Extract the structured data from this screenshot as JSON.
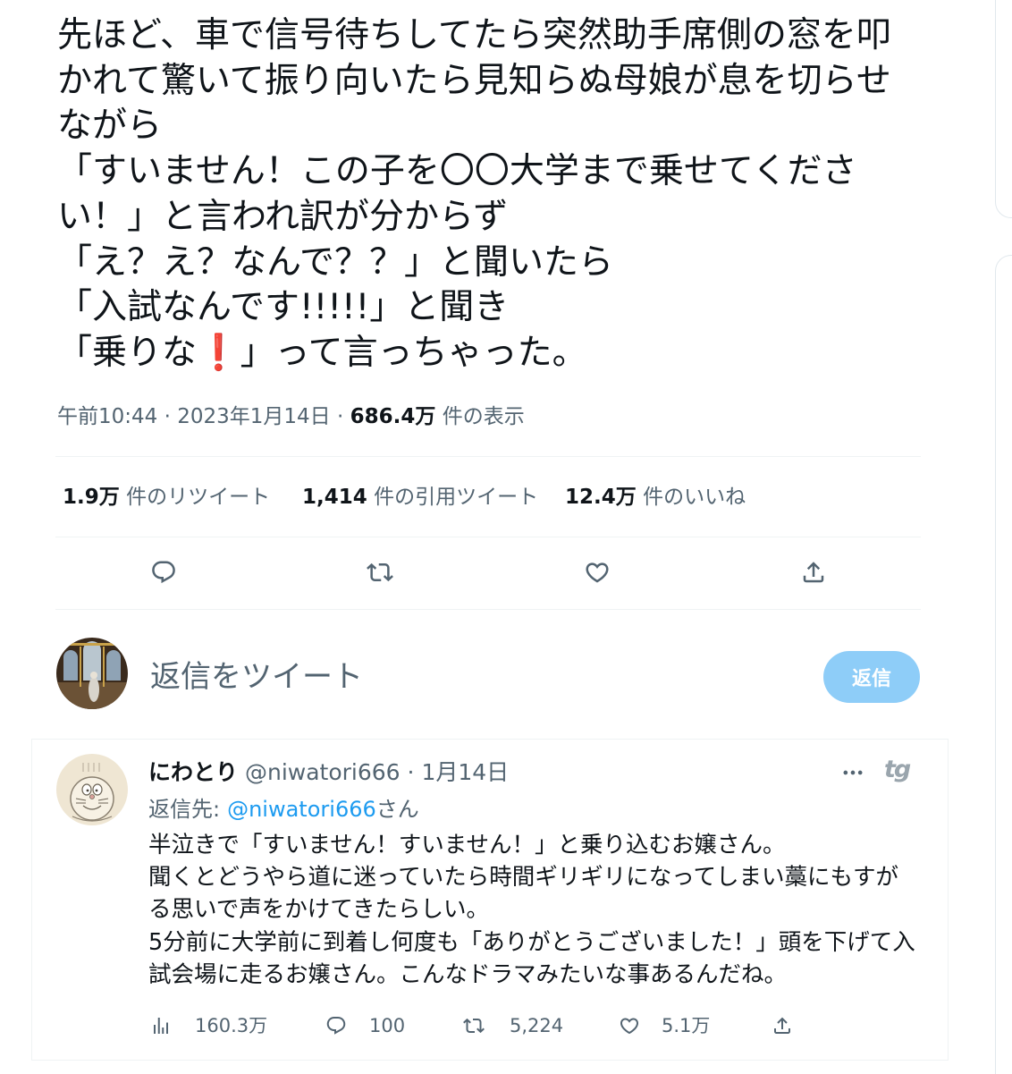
{
  "main_tweet": {
    "lines": [
      "先ほど、車で信号待ちしてたら突然助手席側の窓を叩",
      "かれて驚いて振り向いたら見知らぬ母娘が息を切らせ",
      "ながら",
      "「すいません！この子を〇〇大学まで乗せてくださ",
      "い！」と言われ訳が分からず",
      "「え？え？なんで？？」と聞いたら",
      "「入試なんです!!!!!」と聞き"
    ],
    "last_line": {
      "before": "「乗りな",
      "emoji": "❗",
      "after": "」って言っちゃった。"
    },
    "time": "午前10:44",
    "separator": "·",
    "date": "2023年1月14日",
    "views_count": "686.4万",
    "views_label": "件の表示"
  },
  "stats": [
    {
      "count": "1.9万",
      "label": "件のリツイート"
    },
    {
      "count": "1,414",
      "label": "件の引用ツイート"
    },
    {
      "count": "12.4万",
      "label": "件のいいね"
    }
  ],
  "main_actions": [
    "reply-icon",
    "retweet-icon",
    "like-icon",
    "share-icon"
  ],
  "compose": {
    "placeholder": "返信をツイート",
    "button": "返信"
  },
  "reply": {
    "name": "にわとり",
    "handle": "@niwatori666",
    "separator": "·",
    "date": "1月14日",
    "tg_logo": "tg",
    "reply_to_label": "返信先:",
    "reply_to_handle": "@niwatori666",
    "reply_to_suffix": "さん",
    "lines": [
      "半泣きで「すいません！すいません！」と乗り込むお嬢さん。",
      "聞くとどうやら道に迷っていたら時間ギリギリになってしまい藁にもすが",
      "る思いで声をかけてきたらしい。",
      "5分前に大学前に到着し何度も「ありがとうございました！」頭を下げて入",
      "試会場に走るお嬢さん。こんなドラマみたいな事あるんだね。"
    ],
    "stats": {
      "views": "160.3万",
      "replies": "100",
      "retweets": "5,224",
      "likes": "5.1万"
    },
    "action_icons": [
      "analytics-icon",
      "reply-icon",
      "retweet-icon",
      "like-icon",
      "share-icon"
    ]
  },
  "colors": {
    "text": "#0f1419",
    "secondary": "#536471",
    "link": "#1d9bf0",
    "reply_button_bg": "#8ecdf8",
    "border": "#eff3f4",
    "emoji_red": "#dd2e44"
  }
}
